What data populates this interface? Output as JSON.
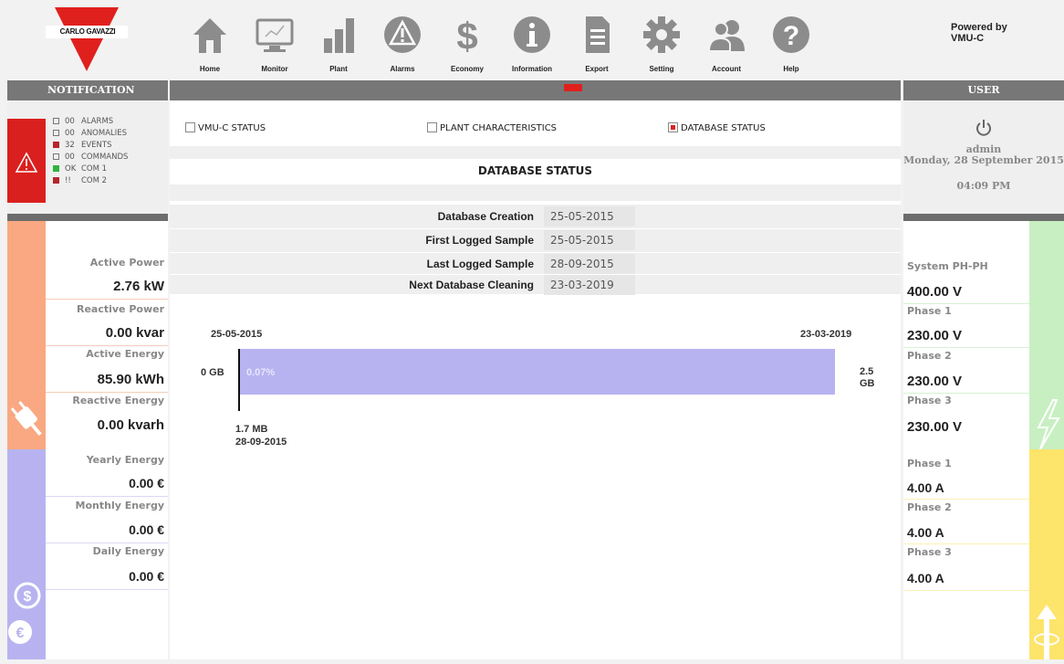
{
  "brand": {
    "logo_text": "CARLO GAVAZZI",
    "powered_by": "Powered by VMU-C"
  },
  "nav": [
    {
      "label": "Home",
      "icon": "home-icon"
    },
    {
      "label": "Monitor",
      "icon": "monitor-icon"
    },
    {
      "label": "Plant",
      "icon": "plant-icon"
    },
    {
      "label": "Alarms",
      "icon": "alarm-icon"
    },
    {
      "label": "Economy",
      "icon": "dollar-icon"
    },
    {
      "label": "Information",
      "icon": "info-icon"
    },
    {
      "label": "Export",
      "icon": "document-icon"
    },
    {
      "label": "Setting",
      "icon": "gear-icon"
    },
    {
      "label": "Account",
      "icon": "users-icon"
    },
    {
      "label": "Help",
      "icon": "help-icon"
    }
  ],
  "sections": {
    "notification": "NOTIFICATION",
    "user": "USER"
  },
  "notifications": [
    {
      "code": "00",
      "label": "ALARMS",
      "status": "empty"
    },
    {
      "code": "00",
      "label": "ANOMALIES",
      "status": "empty"
    },
    {
      "code": "32",
      "label": "EVENTS",
      "status": "red"
    },
    {
      "code": "00",
      "label": "COMMANDS",
      "status": "empty"
    },
    {
      "code": "OK",
      "label": "COM 1",
      "status": "green"
    },
    {
      "code": "!!",
      "label": "COM 2",
      "status": "red"
    }
  ],
  "tabs": [
    {
      "label": "VMU-C STATUS",
      "checked": false
    },
    {
      "label": "PLANT CHARACTERISTICS",
      "checked": false
    },
    {
      "label": "DATABASE STATUS",
      "checked": true
    }
  ],
  "content_title": "DATABASE STATUS",
  "database_info": [
    {
      "label": "Database Creation",
      "value": "25-05-2015"
    },
    {
      "label": "First Logged Sample",
      "value": "25-05-2015"
    },
    {
      "label": "Last Logged Sample",
      "value": "28-09-2015"
    },
    {
      "label": "Next Database Cleaning",
      "value": "23-03-2019"
    }
  ],
  "usage": {
    "start_date": "25-05-2015",
    "end_date": "23-03-2019",
    "min_label": "0 GB",
    "max_label_top": "2.5",
    "max_label_bottom": "GB",
    "percent_label": "0.07%",
    "used_size": "1.7 MB",
    "used_date": "28-09-2015",
    "fraction_used": 0.0007
  },
  "power_measures": [
    {
      "label": "Active Power",
      "value": "2.76 kW"
    },
    {
      "label": "Reactive Power",
      "value": "0.00 kvar"
    },
    {
      "label": "Active Energy",
      "value": "85.90 kWh"
    },
    {
      "label": "Reactive Energy",
      "value": "0.00 kvarh"
    }
  ],
  "economy_measures": [
    {
      "label": "Yearly Energy",
      "value": "0.00 €"
    },
    {
      "label": "Monthly Energy",
      "value": "0.00 €"
    },
    {
      "label": "Daily Energy",
      "value": "0.00 €"
    }
  ],
  "user": {
    "name": "admin",
    "date": "Monday, 28 September 2015",
    "time": "04:09 PM"
  },
  "voltage_measures": [
    {
      "label": "System PH-PH",
      "value": "400.00 V"
    },
    {
      "label": "Phase 1",
      "value": "230.00 V"
    },
    {
      "label": "Phase 2",
      "value": "230.00 V"
    },
    {
      "label": "Phase 3",
      "value": "230.00 V"
    }
  ],
  "current_measures": [
    {
      "label": "Phase 1",
      "value": "4.00 A"
    },
    {
      "label": "Phase 2",
      "value": "4.00 A"
    },
    {
      "label": "Phase 3",
      "value": "4.00 A"
    }
  ],
  "colors": {
    "brand_red": "#e0201d",
    "power_accent": "#f9a882",
    "economy_accent": "#b8b3f0",
    "voltage_accent": "#c8efc2",
    "current_accent": "#fde46a"
  }
}
